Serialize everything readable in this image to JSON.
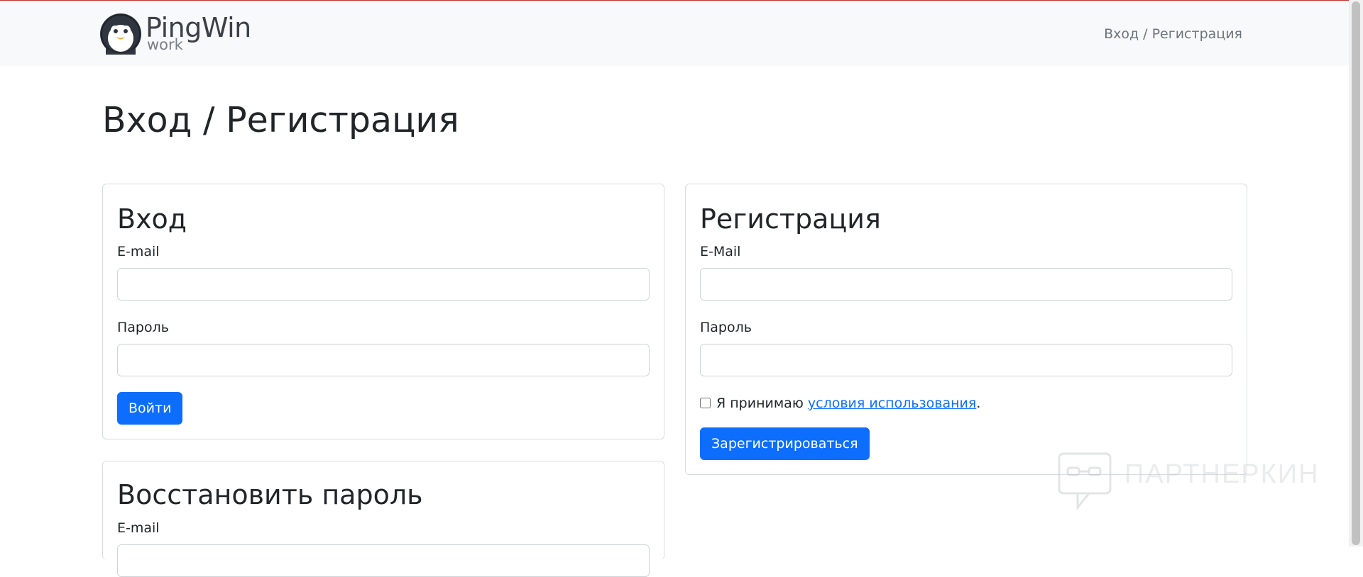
{
  "brand": {
    "name": "PingWin",
    "sub": "work"
  },
  "nav": {
    "link": "Вход / Регистрация"
  },
  "page": {
    "title": "Вход / Регистрация"
  },
  "login": {
    "title": "Вход",
    "email_label": "E-mail",
    "password_label": "Пароль",
    "submit": "Войти"
  },
  "register": {
    "title": "Регистрация",
    "email_label": "E-Mail",
    "password_label": "Пароль",
    "consent_prefix": "Я принимаю",
    "consent_link": "условия использования",
    "consent_suffix": ".",
    "submit": "Зарегистрироваться"
  },
  "recover": {
    "title": "Восстановить пароль",
    "email_label": "E-mail"
  },
  "watermark": {
    "text": "ПАРТНЕРКИН"
  },
  "colors": {
    "primary": "#0d6efd",
    "navbar_bg": "#f8f9fa",
    "text": "#212529"
  },
  "icons": {
    "logo": "penguin-icon"
  }
}
